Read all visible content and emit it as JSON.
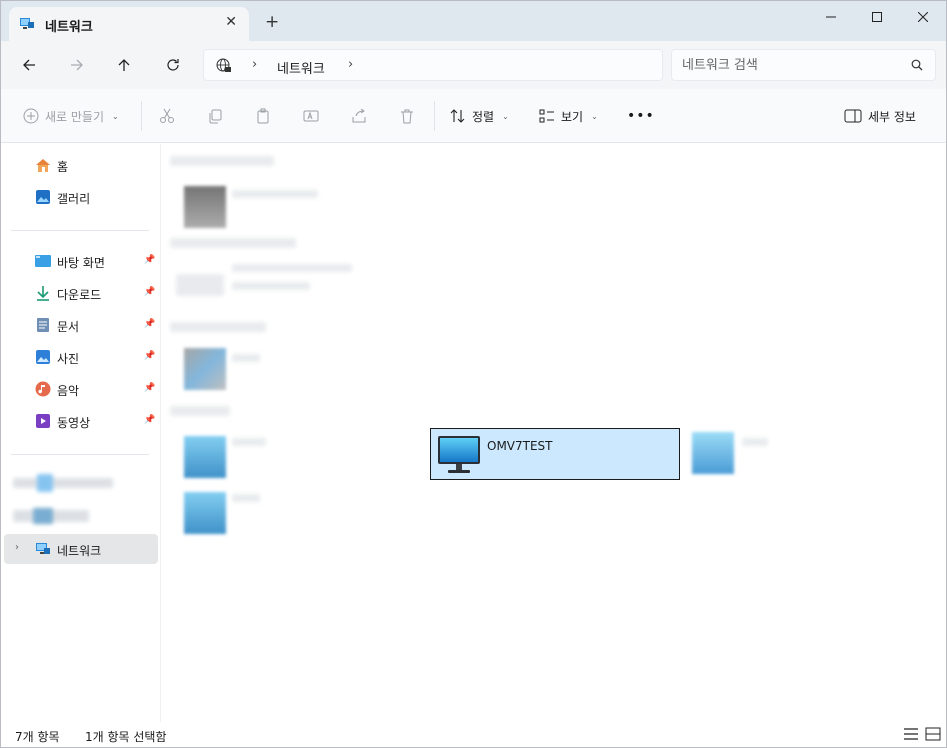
{
  "window": {
    "tab_title": "네트워크",
    "new_tab_symbol": "+",
    "close_tab_symbol": "✕"
  },
  "address": {
    "location": "네트워크",
    "separator": "›"
  },
  "search": {
    "placeholder": "네트워크 검색"
  },
  "toolbar": {
    "new_label": "새로 만들기",
    "sort_label": "정렬",
    "view_label": "보기",
    "more_label": "•••",
    "details_label": "세부 정보"
  },
  "sidebar": {
    "items": [
      {
        "label": "홈",
        "icon": "home-icon"
      },
      {
        "label": "갤러리",
        "icon": "gallery-icon"
      },
      {
        "label": "바탕 화면",
        "icon": "desktop-icon",
        "pinned": true
      },
      {
        "label": "다운로드",
        "icon": "download-icon",
        "pinned": true
      },
      {
        "label": "문서",
        "icon": "documents-icon",
        "pinned": true
      },
      {
        "label": "사진",
        "icon": "pictures-icon",
        "pinned": true
      },
      {
        "label": "음악",
        "icon": "music-icon",
        "pinned": true
      },
      {
        "label": "동영상",
        "icon": "videos-icon",
        "pinned": true
      }
    ],
    "network_label": "네트워크"
  },
  "content": {
    "selected_item": "OMV7TEST"
  },
  "status": {
    "item_count": "7개 항목",
    "selection": "1개 항목 선택함"
  },
  "colors": {
    "accent": "#0067c0",
    "selection_bg": "#cce8ff",
    "titlebar_bg": "#dfe7ef"
  }
}
